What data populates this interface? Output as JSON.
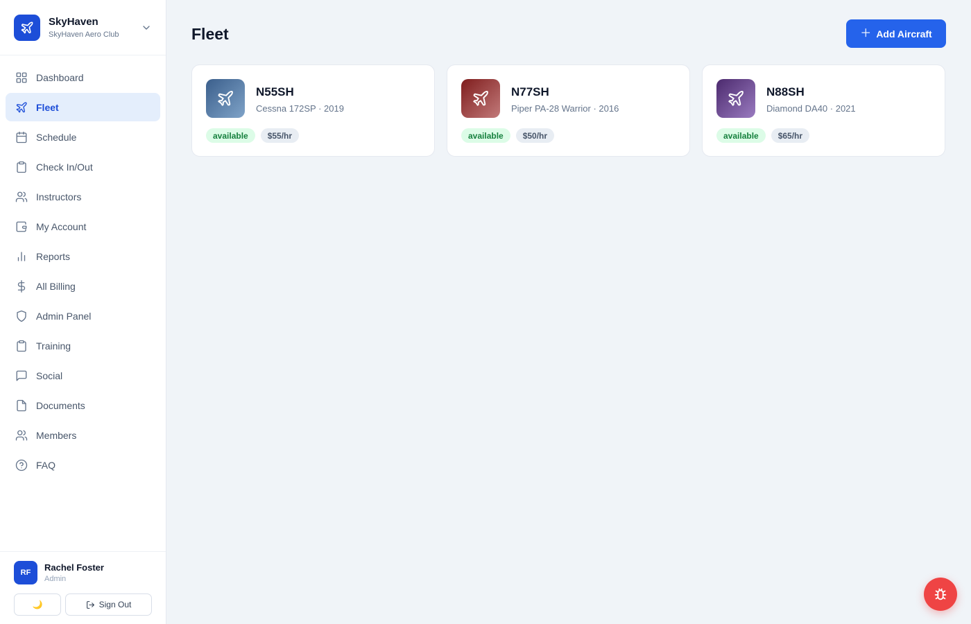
{
  "brand": {
    "name": "SkyHaven",
    "subtitle": "SkyHaven Aero Club",
    "icon": "plane-icon"
  },
  "nav": [
    {
      "label": "Dashboard",
      "icon": "grid-icon",
      "active": false
    },
    {
      "label": "Fleet",
      "icon": "plane-icon",
      "active": true
    },
    {
      "label": "Schedule",
      "icon": "calendar-icon",
      "active": false
    },
    {
      "label": "Check In/Out",
      "icon": "clipboard-icon",
      "active": false
    },
    {
      "label": "Instructors",
      "icon": "users-icon",
      "active": false
    },
    {
      "label": "My Account",
      "icon": "wallet-icon",
      "active": false
    },
    {
      "label": "Reports",
      "icon": "bar-chart-icon",
      "active": false
    },
    {
      "label": "All Billing",
      "icon": "dollar-icon",
      "active": false
    },
    {
      "label": "Admin Panel",
      "icon": "shield-icon",
      "active": false
    },
    {
      "label": "Training",
      "icon": "clipboard-icon",
      "active": false
    },
    {
      "label": "Social",
      "icon": "message-icon",
      "active": false
    },
    {
      "label": "Documents",
      "icon": "file-icon",
      "active": false
    },
    {
      "label": "Members",
      "icon": "users-icon",
      "active": false
    },
    {
      "label": "FAQ",
      "icon": "help-circle-icon",
      "active": false
    }
  ],
  "user": {
    "initials": "RF",
    "name": "Rachel Foster",
    "role": "Admin",
    "theme_icon": "🌙",
    "signout_label": "Sign Out"
  },
  "page": {
    "title": "Fleet",
    "add_button_label": "Add Aircraft"
  },
  "aircraft": [
    {
      "registration": "N55SH",
      "model": "Cessna 172SP · 2019",
      "status": "available",
      "rate": "$55/hr",
      "color_from": "#3b5f8c",
      "color_to": "#7fa3c8"
    },
    {
      "registration": "N77SH",
      "model": "Piper PA-28 Warrior · 2016",
      "status": "available",
      "rate": "$50/hr",
      "color_from": "#7f1d1d",
      "color_to": "#c27a7a"
    },
    {
      "registration": "N88SH",
      "model": "Diamond DA40 · 2021",
      "status": "available",
      "rate": "$65/hr",
      "color_from": "#4c2a6e",
      "color_to": "#9a7bc0"
    }
  ],
  "colors": {
    "accent": "#2563eb",
    "active_nav_bg": "#e4eefc",
    "status_green": "#15803d",
    "bug_button": "#ef4444"
  }
}
